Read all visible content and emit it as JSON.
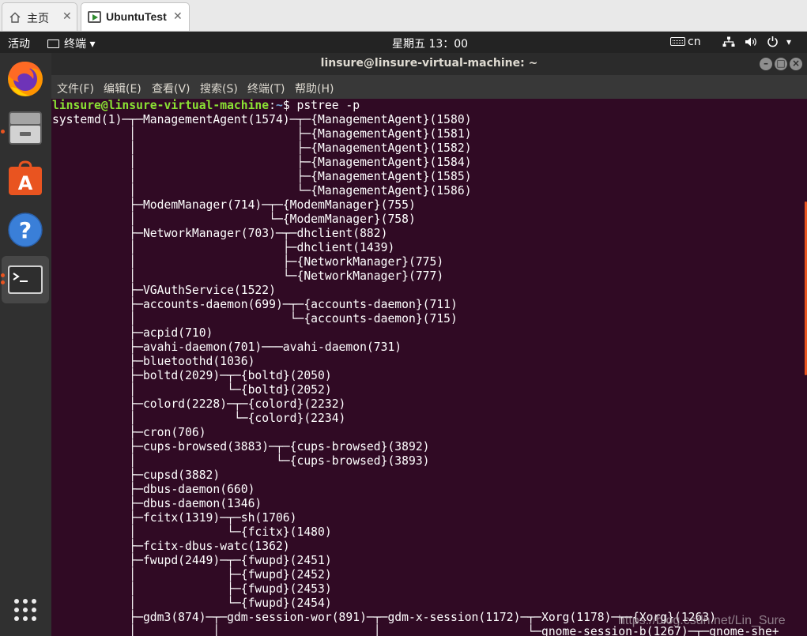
{
  "host_tabs": [
    {
      "label": "主页",
      "close": "✕"
    },
    {
      "label": "UbuntuTest",
      "close": "✕"
    }
  ],
  "topbar": {
    "activities": "活动",
    "app_menu": "终端 ▾",
    "clock": "星期五 13：00",
    "input_method": "cn",
    "status_icons": [
      "network-icon",
      "volume-icon",
      "power-icon"
    ],
    "dropdown": "▾"
  },
  "dock": [
    "firefox-icon",
    "files-icon",
    "software-center-icon",
    "help-icon",
    "terminal-icon",
    "show-apps-icon"
  ],
  "window": {
    "title": "linsure@linsure-virtual-machine: ~",
    "buttons": [
      "minimize",
      "maximize",
      "close"
    ]
  },
  "menu": [
    "文件(F)",
    "编辑(E)",
    "查看(V)",
    "搜索(S)",
    "终端(T)",
    "帮助(H)"
  ],
  "terminal": {
    "prompt_user": "linsure@linsure-virtual-machine",
    "prompt_sep": ":",
    "prompt_path": "~",
    "prompt_end": "$ ",
    "command": "pstree -p",
    "output": [
      "systemd(1)─┬─ManagementAgent(1574)─┬─{ManagementAgent}(1580)",
      "           │                       ├─{ManagementAgent}(1581)",
      "           │                       ├─{ManagementAgent}(1582)",
      "           │                       ├─{ManagementAgent}(1584)",
      "           │                       ├─{ManagementAgent}(1585)",
      "           │                       └─{ManagementAgent}(1586)",
      "           ├─ModemManager(714)─┬─{ModemManager}(755)",
      "           │                   └─{ModemManager}(758)",
      "           ├─NetworkManager(703)─┬─dhclient(882)",
      "           │                     ├─dhclient(1439)",
      "           │                     ├─{NetworkManager}(775)",
      "           │                     └─{NetworkManager}(777)",
      "           ├─VGAuthService(1522)",
      "           ├─accounts-daemon(699)─┬─{accounts-daemon}(711)",
      "           │                      └─{accounts-daemon}(715)",
      "           ├─acpid(710)",
      "           ├─avahi-daemon(701)───avahi-daemon(731)",
      "           ├─bluetoothd(1036)",
      "           ├─boltd(2029)─┬─{boltd}(2050)",
      "           │             └─{boltd}(2052)",
      "           ├─colord(2228)─┬─{colord}(2232)",
      "           │              └─{colord}(2234)",
      "           ├─cron(706)",
      "           ├─cups-browsed(3883)─┬─{cups-browsed}(3892)",
      "           │                    └─{cups-browsed}(3893)",
      "           ├─cupsd(3882)",
      "           ├─dbus-daemon(660)",
      "           ├─dbus-daemon(1346)",
      "           ├─fcitx(1319)─┬─sh(1706)",
      "           │             └─{fcitx}(1480)",
      "           ├─fcitx-dbus-watc(1362)",
      "           ├─fwupd(2449)─┬─{fwupd}(2451)",
      "           │             ├─{fwupd}(2452)",
      "           │             ├─{fwupd}(2453)",
      "           │             └─{fwupd}(2454)",
      "           ├─gdm3(874)─┬─gdm-session-wor(891)─┬─gdm-x-session(1172)─┬─Xorg(1178)─┬─{Xorg}(1263)",
      "           │           │                      │                     └─gnome-session-b(1267)─┬─gnome-she+"
    ]
  },
  "watermark": "https://blog.csdn.net/Lin_Sure"
}
